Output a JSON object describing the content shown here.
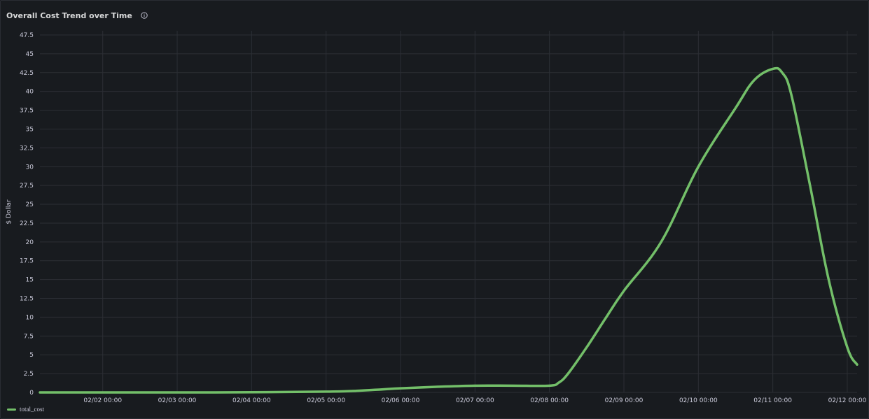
{
  "panel": {
    "title": "Overall Cost Trend over Time",
    "info_icon": "info-circle-icon"
  },
  "colors": {
    "background": "#181b1f",
    "grid": "#2c2f35",
    "series": "#73bf69",
    "text": "#ccccdc"
  },
  "chart_data": {
    "type": "line",
    "title": "Overall Cost Trend over Time",
    "xlabel": "",
    "ylabel": "$ Dollar",
    "ylim": [
      0,
      47.5
    ],
    "xlim": [
      "02/01 03:45",
      "02/12 03:10"
    ],
    "y_ticks": [
      "0",
      "2.5",
      "5",
      "7.5",
      "10",
      "12.5",
      "15",
      "17.5",
      "20",
      "22.5",
      "25",
      "27.5",
      "30",
      "32.5",
      "35",
      "37.5",
      "40",
      "42.5",
      "45",
      "47.5"
    ],
    "x_ticks": [
      "02/02 00:00",
      "02/03 00:00",
      "02/04 00:00",
      "02/05 00:00",
      "02/06 00:00",
      "02/07 00:00",
      "02/08 00:00",
      "02/09 00:00",
      "02/10 00:00",
      "02/11 00:00",
      "02/12 00:00"
    ],
    "grid": true,
    "legend_position": "bottom-left",
    "series": [
      {
        "name": "total_cost",
        "color": "#73bf69",
        "points": [
          [
            "02/01 03:45",
            0
          ],
          [
            "02/02 00:00",
            0
          ],
          [
            "02/03 00:00",
            0
          ],
          [
            "02/04 00:00",
            0.02
          ],
          [
            "02/05 00:00",
            0.1
          ],
          [
            "02/05 09:00",
            0.2
          ],
          [
            "02/05 18:00",
            0.4
          ],
          [
            "02/06 00:00",
            0.55
          ],
          [
            "02/06 12:00",
            0.75
          ],
          [
            "02/07 00:00",
            0.9
          ],
          [
            "02/07 12:00",
            0.9
          ],
          [
            "02/08 00:00",
            0.9
          ],
          [
            "02/08 03:00",
            1.3
          ],
          [
            "02/08 06:00",
            2.5
          ],
          [
            "02/08 12:00",
            6.0
          ],
          [
            "02/08 18:00",
            9.8
          ],
          [
            "02/09 00:00",
            13.5
          ],
          [
            "02/09 12:00",
            20.0
          ],
          [
            "02/10 00:00",
            30.0
          ],
          [
            "02/10 12:00",
            37.8
          ],
          [
            "02/10 18:00",
            41.5
          ],
          [
            "02/11 00:00",
            43.0
          ],
          [
            "02/11 03:00",
            42.5
          ],
          [
            "02/11 06:00",
            39.5
          ],
          [
            "02/11 12:00",
            27.5
          ],
          [
            "02/11 18:00",
            15.0
          ],
          [
            "02/12 00:00",
            6.0
          ],
          [
            "02/12 03:10",
            3.7
          ]
        ]
      }
    ]
  }
}
